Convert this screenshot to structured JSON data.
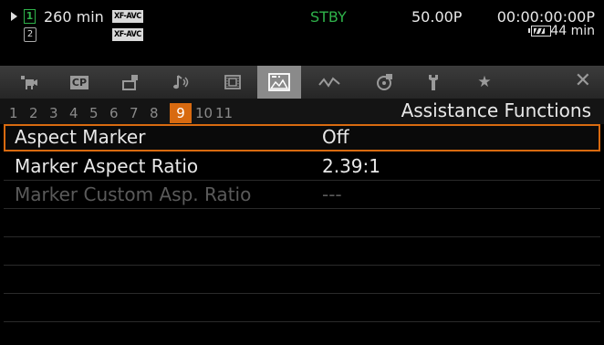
{
  "status": {
    "card_slot": "1",
    "rec_time": "260 min",
    "format_1": "XF-AVC",
    "format_2": "XF-AVC",
    "slot2": "2",
    "mode": "STBY",
    "frame_rate": "50.00P",
    "timecode": "00:00:00:00P",
    "battery_time": "44 min",
    "battery_level": 0.75
  },
  "tabs": [
    {
      "icon": "movie-camera-icon"
    },
    {
      "icon": "custom-picture-icon",
      "label": "CP"
    },
    {
      "icon": "camera-setup-icon"
    },
    {
      "icon": "audio-icon"
    },
    {
      "icon": "film-icon"
    },
    {
      "icon": "assistance-functions-icon",
      "active": true
    },
    {
      "icon": "wave-output-icon"
    },
    {
      "icon": "recording-media-icon"
    },
    {
      "icon": "wrench-icon"
    },
    {
      "icon": "star-icon"
    }
  ],
  "close_label": "✕",
  "pages": [
    "1",
    "2",
    "3",
    "4",
    "5",
    "6",
    "7",
    "8",
    "9",
    "10",
    "11"
  ],
  "active_page": "9",
  "menu_title": "Assistance Functions",
  "items": [
    {
      "label": "Aspect Marker",
      "value": "Off",
      "state": "selected"
    },
    {
      "label": "Marker Aspect Ratio",
      "value": "2.39:1",
      "state": "normal"
    },
    {
      "label": "Marker Custom Asp. Ratio",
      "value": "---",
      "state": "disabled"
    }
  ]
}
